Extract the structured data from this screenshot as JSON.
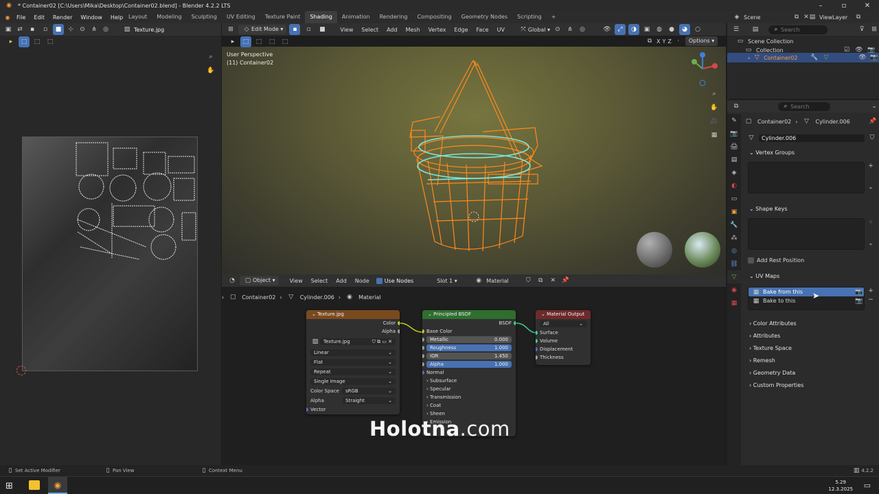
{
  "window": {
    "title": "* Container02 [C:\\Users\\Mika\\Desktop\\Container02.blend] - Blender 4.2.2 LTS"
  },
  "menu": [
    "File",
    "Edit",
    "Render",
    "Window",
    "Help"
  ],
  "workspaces": [
    "Layout",
    "Modeling",
    "Sculpting",
    "UV Editing",
    "Texture Paint",
    "Shading",
    "Animation",
    "Rendering",
    "Compositing",
    "Geometry Nodes",
    "Scripting"
  ],
  "active_workspace": "Shading",
  "scene": {
    "scene_name": "Scene",
    "view_layer": "ViewLayer"
  },
  "uv_editor": {
    "image_name": "Texture.jpg"
  },
  "viewport": {
    "mode": "Edit Mode",
    "menus": [
      "View",
      "Select",
      "Add",
      "Mesh",
      "Vertex",
      "Edge",
      "Face",
      "UV"
    ],
    "transform_orientation": "Global",
    "options_label": "Options",
    "info_line1": "User Perspective",
    "info_line2": "(11) Container02",
    "axes": [
      "X",
      "Y",
      "Z"
    ]
  },
  "node_editor": {
    "object_mode": "Object",
    "menus": [
      "View",
      "Select",
      "Add",
      "Node"
    ],
    "use_nodes_label": "Use Nodes",
    "slot": "Slot 1",
    "material": "Material",
    "breadcrumb": [
      "Container02",
      "Cylinder.006",
      "Material"
    ],
    "texture_node": {
      "title": "Texture.jpg",
      "outputs": [
        "Color",
        "Alpha"
      ],
      "image": "Texture.jpg",
      "interpolation": "Linear",
      "projection": "Flat",
      "extension": "Repeat",
      "source": "Single Image",
      "color_space_label": "Color Space",
      "color_space": "sRGB",
      "alpha_label": "Alpha",
      "alpha_mode": "Straight",
      "input": "Vector"
    },
    "bsdf_node": {
      "title": "Principled BSDF",
      "output": "BSDF",
      "base_color": "Base Color",
      "fields": [
        {
          "label": "Metallic",
          "value": "0.000",
          "fill": 0.0
        },
        {
          "label": "Roughness",
          "value": "1.000",
          "fill": 1.0
        },
        {
          "label": "IOR",
          "value": "1.450",
          "fill": 1.0
        },
        {
          "label": "Alpha",
          "value": "1.000",
          "fill": 1.0
        }
      ],
      "normal": "Normal",
      "panels": [
        "Subsurface",
        "Specular",
        "Transmission",
        "Coat",
        "Sheen",
        "Emission"
      ]
    },
    "output_node": {
      "title": "Material Output",
      "target": "All",
      "inputs": [
        "Surface",
        "Volume",
        "Displacement",
        "Thickness"
      ]
    }
  },
  "outliner": {
    "search_placeholder": "Search",
    "items": [
      "Scene Collection",
      "Collection",
      "Container02"
    ]
  },
  "properties": {
    "search_placeholder": "Search",
    "breadcrumb": [
      "Container02",
      "Cylinder.006"
    ],
    "mesh_name": "Cylinder.006",
    "sections": {
      "vertex_groups": "Vertex Groups",
      "shape_keys": "Shape Keys",
      "add_rest_position": "Add Rest Position",
      "uv_maps": "UV Maps",
      "uv_map_items": [
        "Bake from this",
        "Bake to this"
      ],
      "collapsed": [
        "Color Attributes",
        "Attributes",
        "Texture Space",
        "Remesh",
        "Geometry Data",
        "Custom Properties"
      ]
    }
  },
  "statusbar": {
    "left": "Set Active Modifier",
    "middle": "Pan View",
    "right": "Context Menu",
    "version": "4.2.2"
  },
  "taskbar": {
    "time": "5.29",
    "date": "12.3.2025"
  },
  "watermark": {
    "bold": "Holotna",
    "rest": ".com"
  },
  "colors": {
    "accent": "#4772b3",
    "wire": "#ff8a1d",
    "seam": "#7fe3d8",
    "texture_header": "#7a4a1f",
    "bsdf_header": "#2f6e2f",
    "output_header": "#6e2a2a"
  }
}
